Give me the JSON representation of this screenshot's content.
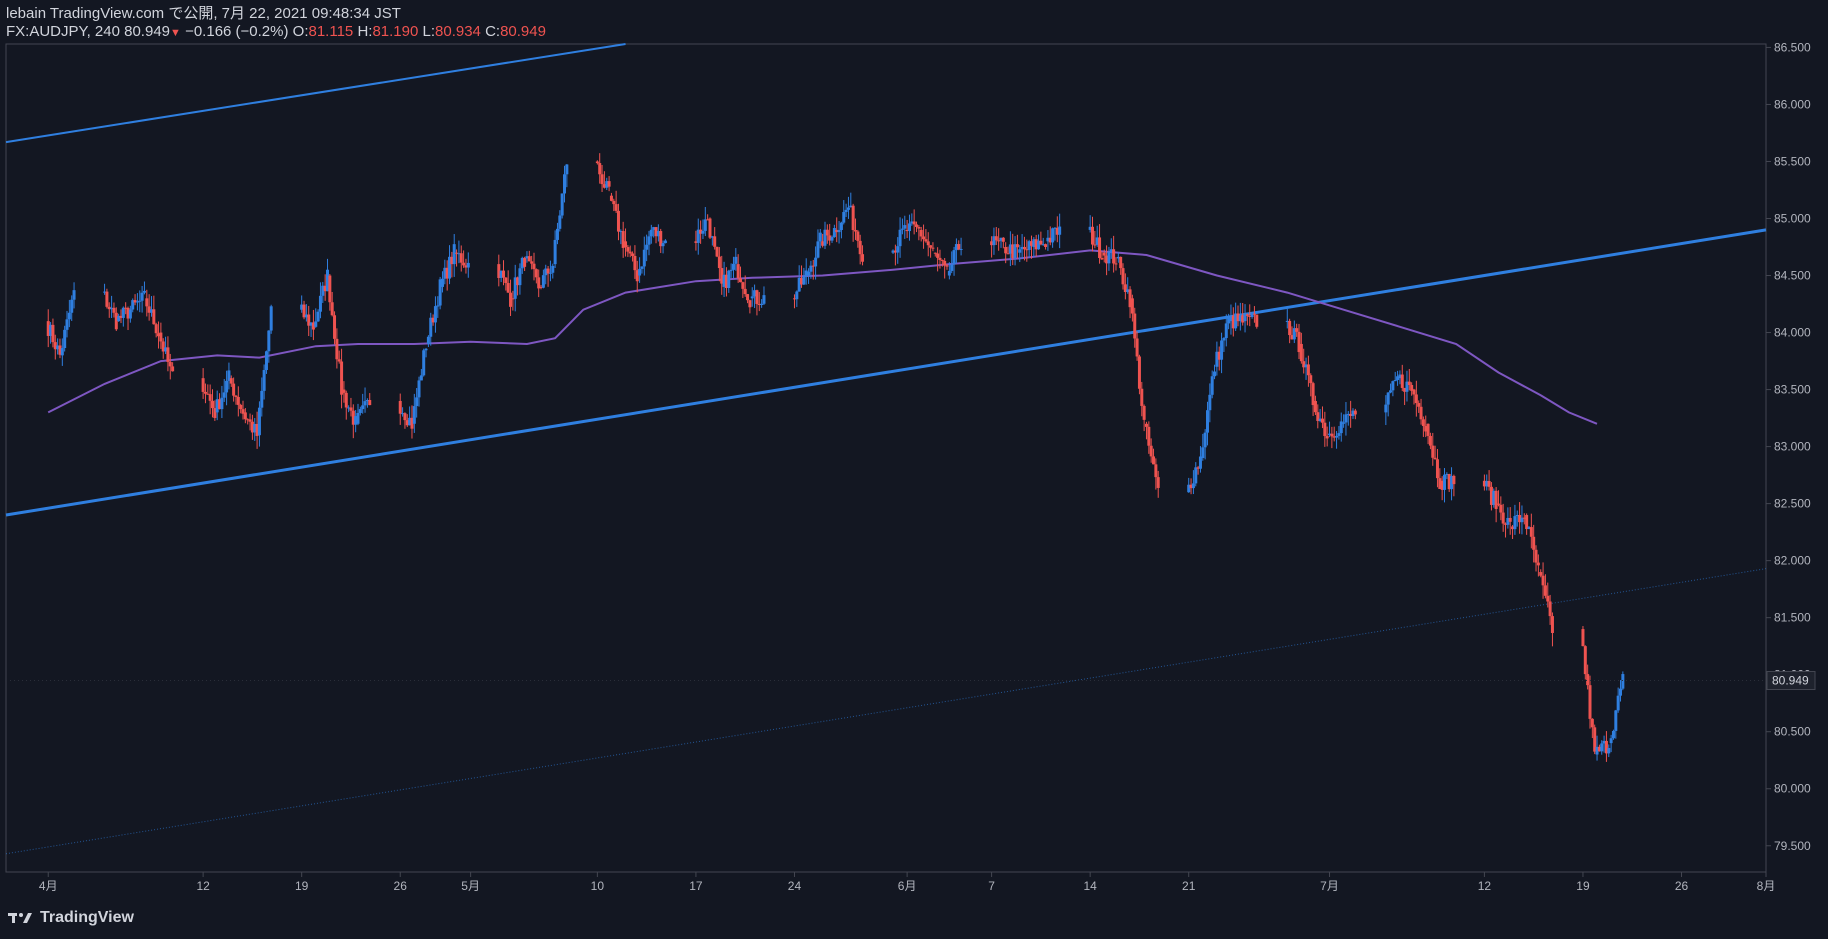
{
  "header": {
    "publish_line": "lebain TradingView.com で公開, 7月 22, 2021 09:48:34 JST",
    "symbol": "FX:AUDJPY, 240",
    "last": "80.949",
    "change": "−0.166 (−0.2%)",
    "o_label": "O:",
    "o_val": "81.115",
    "h_label": "H:",
    "h_val": "81.190",
    "l_label": "L:",
    "l_val": "80.934",
    "c_label": "C:",
    "c_val": "80.949"
  },
  "footer": {
    "brand": "TradingView"
  },
  "colors": {
    "background": "#131722",
    "up": "#2962ff",
    "up_body": "#2f7fe0",
    "down": "#ef5350",
    "ma": "#7e57c2",
    "trendline": "#2f7fe0",
    "grid_border": "#434651",
    "price_badge": "#1e222d"
  },
  "chart_data": {
    "type": "candlestick",
    "symbol": "FX:AUDJPY",
    "interval": "240",
    "y_ticks": [
      "79.500",
      "80.000",
      "80.500",
      "81.000",
      "81.500",
      "82.000",
      "82.500",
      "83.000",
      "83.500",
      "84.000",
      "84.500",
      "85.000",
      "85.500",
      "86.000",
      "86.500"
    ],
    "ylim": [
      79.27,
      86.53
    ],
    "x_ticks": [
      "4月",
      "12",
      "19",
      "26",
      "5月",
      "10",
      "17",
      "24",
      "6月",
      "7",
      "14",
      "21",
      "7月",
      "12",
      "19",
      "26",
      "8月"
    ],
    "last_price_label": "80.949",
    "anchors": [
      [
        "04-01",
        84.1
      ],
      [
        "04-02",
        83.8
      ],
      [
        "04-05",
        84.35
      ],
      [
        "04-06",
        84.1
      ],
      [
        "04-08",
        84.3
      ],
      [
        "04-09",
        84.0
      ],
      [
        "04-12",
        83.6
      ],
      [
        "04-13",
        83.3
      ],
      [
        "04-14",
        83.6
      ],
      [
        "04-15",
        83.3
      ],
      [
        "04-16",
        83.1
      ],
      [
        "04-19",
        84.2
      ],
      [
        "04-20",
        84.05
      ],
      [
        "04-21",
        84.5
      ],
      [
        "04-22",
        83.5
      ],
      [
        "04-23",
        83.2
      ],
      [
        "04-26",
        83.4
      ],
      [
        "04-27",
        83.2
      ],
      [
        "04-28",
        83.9
      ],
      [
        "04-29",
        84.4
      ],
      [
        "04-30",
        84.7
      ],
      [
        "05-03",
        84.6
      ],
      [
        "05-04",
        84.3
      ],
      [
        "05-05",
        84.65
      ],
      [
        "05-06",
        84.4
      ],
      [
        "05-07",
        84.6
      ],
      [
        "05-10",
        85.5
      ],
      [
        "05-11",
        85.2
      ],
      [
        "05-12",
        84.8
      ],
      [
        "05-13",
        84.5
      ],
      [
        "05-14",
        84.9
      ],
      [
        "05-17",
        84.8
      ],
      [
        "05-18",
        85.0
      ],
      [
        "05-19",
        84.4
      ],
      [
        "05-20",
        84.6
      ],
      [
        "05-21",
        84.3
      ],
      [
        "05-24",
        84.3
      ],
      [
        "05-25",
        84.5
      ],
      [
        "05-26",
        84.8
      ],
      [
        "05-27",
        84.9
      ],
      [
        "05-28",
        85.1
      ],
      [
        "05-31",
        84.7
      ],
      [
        "06-01",
        84.9
      ],
      [
        "06-02",
        84.9
      ],
      [
        "06-03",
        84.7
      ],
      [
        "06-04",
        84.5
      ],
      [
        "06-07",
        84.8
      ],
      [
        "06-08",
        84.75
      ],
      [
        "06-09",
        84.7
      ],
      [
        "06-10",
        84.75
      ],
      [
        "06-11",
        84.8
      ],
      [
        "06-14",
        84.9
      ],
      [
        "06-15",
        84.7
      ],
      [
        "06-16",
        84.65
      ],
      [
        "06-17",
        84.3
      ],
      [
        "06-18",
        83.2
      ],
      [
        "06-21",
        82.6
      ],
      [
        "06-22",
        82.9
      ],
      [
        "06-23",
        83.7
      ],
      [
        "06-24",
        84.1
      ],
      [
        "06-25",
        84.1
      ],
      [
        "06-28",
        84.1
      ],
      [
        "06-29",
        83.9
      ],
      [
        "06-30",
        83.4
      ],
      [
        "07-01",
        83.1
      ],
      [
        "07-02",
        83.2
      ],
      [
        "07-05",
        83.3
      ],
      [
        "07-06",
        83.6
      ],
      [
        "07-07",
        83.5
      ],
      [
        "07-08",
        83.2
      ],
      [
        "07-09",
        82.7
      ],
      [
        "07-12",
        82.7
      ],
      [
        "07-13",
        82.5
      ],
      [
        "07-14",
        82.3
      ],
      [
        "07-15",
        82.4
      ],
      [
        "07-16",
        81.9
      ],
      [
        "07-19",
        81.4
      ],
      [
        "07-20",
        80.3
      ],
      [
        "07-21",
        80.4
      ],
      [
        "07-22",
        80.949
      ]
    ],
    "ma_series": [
      [
        "04-01",
        83.3
      ],
      [
        "04-05",
        83.55
      ],
      [
        "04-09",
        83.75
      ],
      [
        "04-13",
        83.8
      ],
      [
        "04-16",
        83.78
      ],
      [
        "04-20",
        83.88
      ],
      [
        "04-23",
        83.9
      ],
      [
        "04-27",
        83.9
      ],
      [
        "05-01",
        83.92
      ],
      [
        "05-05",
        83.9
      ],
      [
        "05-07",
        83.95
      ],
      [
        "05-09",
        84.2
      ],
      [
        "05-12",
        84.35
      ],
      [
        "05-17",
        84.45
      ],
      [
        "05-21",
        84.48
      ],
      [
        "05-26",
        84.5
      ],
      [
        "05-31",
        84.55
      ],
      [
        "06-04",
        84.6
      ],
      [
        "06-09",
        84.65
      ],
      [
        "06-14",
        84.72
      ],
      [
        "06-18",
        84.68
      ],
      [
        "06-23",
        84.5
      ],
      [
        "06-28",
        84.35
      ],
      [
        "07-02",
        84.2
      ],
      [
        "07-06",
        84.05
      ],
      [
        "07-10",
        83.9
      ],
      [
        "07-13",
        83.65
      ],
      [
        "07-16",
        83.45
      ],
      [
        "07-18",
        83.3
      ],
      [
        "07-20",
        83.2
      ]
    ],
    "trendlines": [
      {
        "name": "",
        "from": [
          "03-29",
          85.67
        ],
        "to": [
          "05-12",
          86.53
        ]
      },
      {
        "name": "",
        "from": [
          "03-29",
          82.4
        ],
        "to": [
          "08-01",
          84.9
        ]
      },
      {
        "name": "",
        "from": [
          "03-29",
          79.43
        ],
        "to": [
          "08-01",
          81.93
        ]
      }
    ]
  }
}
